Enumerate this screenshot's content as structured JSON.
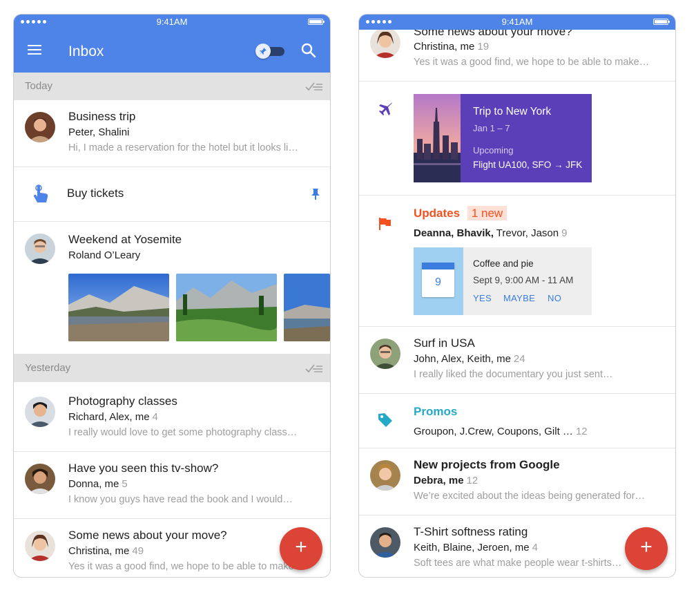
{
  "status": {
    "time": "9:41AM"
  },
  "left": {
    "appbar": {
      "title": "Inbox"
    },
    "sections": [
      {
        "label": "Today"
      },
      {
        "label": "Yesterday"
      }
    ],
    "rows": [
      {
        "title": "Business trip",
        "senders": "Peter, Shalini",
        "count": "",
        "snippet": "Hi, I made a reservation for the hotel but it looks li…"
      },
      {
        "title": "Buy tickets"
      },
      {
        "title": "Weekend at Yosemite",
        "senders": "Roland O’Leary"
      },
      {
        "title": "Photography classes",
        "senders": "Richard, Alex, me",
        "count": "4",
        "snippet": "I really would love to get some photography class…"
      },
      {
        "title": "Have you seen this tv-show?",
        "senders": "Donna, me",
        "count": "5",
        "snippet": "I know you guys have read the book and I would…"
      },
      {
        "title": "Some news about your move?",
        "senders": "Christina, me",
        "count": "49",
        "snippet": "Yes it was a good find, we hope to be able to make…"
      }
    ],
    "fab_label": "+"
  },
  "right": {
    "rows": [
      {
        "title": "Some news about your move?",
        "senders": "Christina, me",
        "count": "19",
        "snippet": "Yes it was a good find, we hope to be able to make…"
      },
      {
        "trip": {
          "title": "Trip to New York",
          "dates": "Jan 1 – 7",
          "status": "Upcoming",
          "flight": "Flight UA100,  SFO → JFK"
        }
      },
      {
        "title": "Updates",
        "badge": "1 new",
        "senders_bold": "Deanna, Bhavik,",
        "senders_rest": " Trevor, Jason",
        "count": "9",
        "event": {
          "title": "Coffee and pie",
          "day": "9",
          "time": "Sept 9, 9:00 AM - 11 AM",
          "yes": "YES",
          "maybe": "MAYBE",
          "no": "NO"
        }
      },
      {
        "title": "Surf in USA",
        "senders": "John, Alex, Keith, me",
        "count": "24",
        "snippet": "I really liked the documentary you just sent…"
      },
      {
        "title": "Promos",
        "senders": "Groupon, J.Crew, Coupons, Gilt …",
        "count": "12"
      },
      {
        "title": "New projects from Google",
        "senders": "Debra, me",
        "count": "12",
        "snippet": "We’re excited about the ideas being generated for…"
      },
      {
        "title": "T-Shirt softness rating",
        "senders": "Keith, Blaine, Jeroen, me",
        "count": "4",
        "snippet": "Soft tees are what make people wear t-shirts…"
      }
    ],
    "fab_label": "+"
  },
  "colors": {
    "primary": "#4e83e8",
    "fab": "#db4437",
    "updates": "#f4511e",
    "promos": "#26a9c6",
    "trip": "#5b3fb8",
    "pin": "#3b7ddd"
  },
  "icons": [
    "menu-icon",
    "pin-toggle",
    "search-icon",
    "sweep-icon",
    "reminder-hand-icon",
    "pin-icon",
    "airplane-icon",
    "flag-icon",
    "tag-icon",
    "calendar-icon"
  ]
}
